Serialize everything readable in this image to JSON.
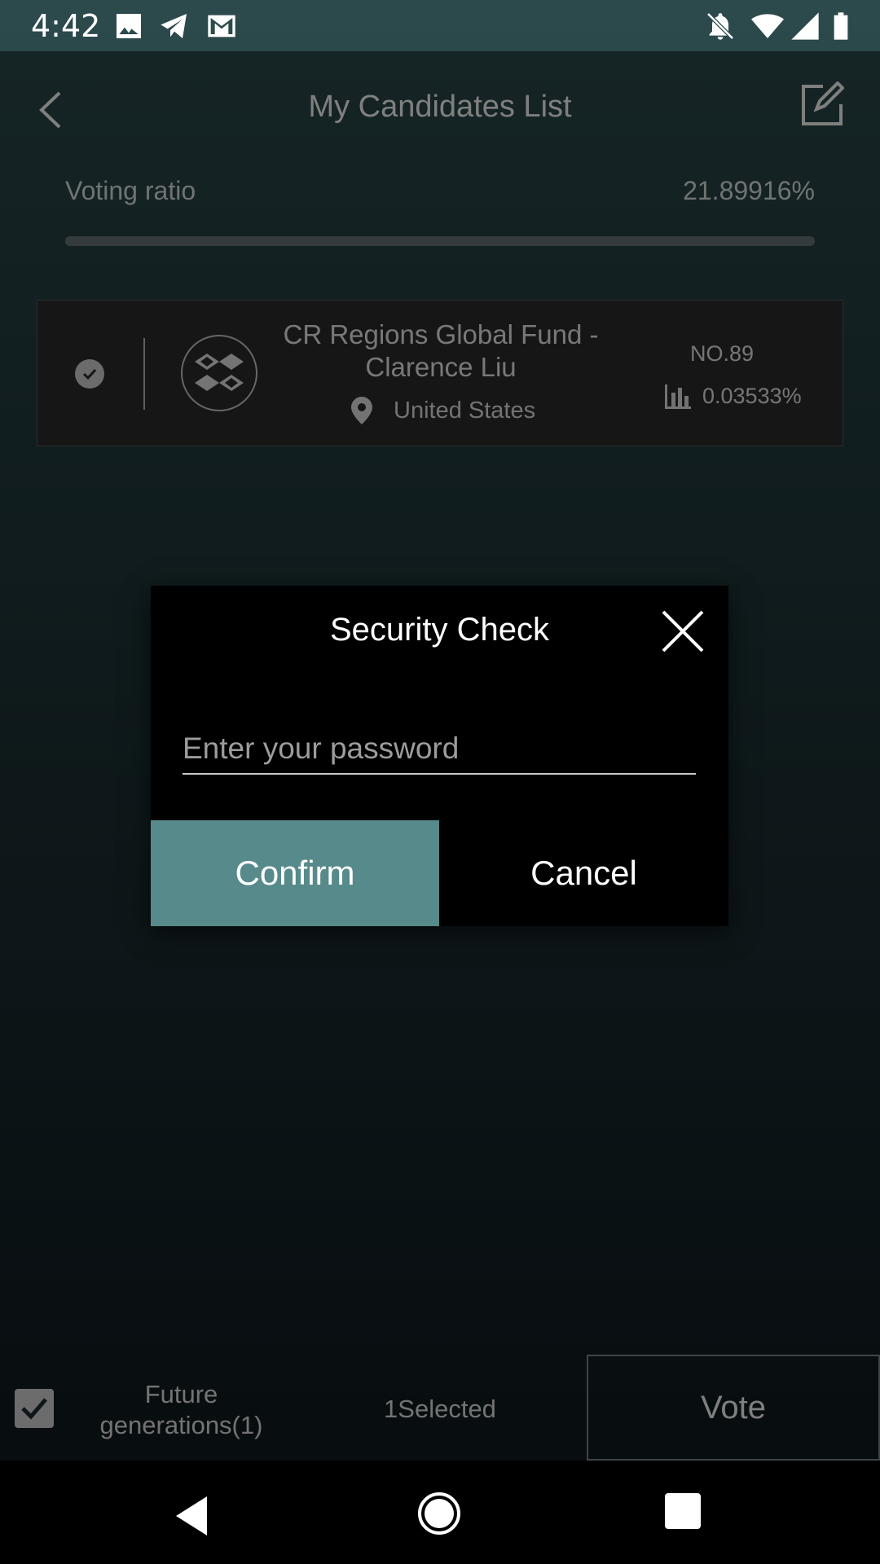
{
  "status_bar": {
    "time": "4:42",
    "icons_left": [
      "image-icon",
      "telegram-icon",
      "gmail-icon"
    ],
    "icons_right": [
      "notifications-off-icon",
      "wifi-icon",
      "signal-icon",
      "battery-icon"
    ]
  },
  "header": {
    "title": "My Candidates List",
    "back_icon": "chevron-left-icon",
    "edit_icon": "edit-icon"
  },
  "voting_ratio": {
    "label": "Voting ratio",
    "value": "21.89916%"
  },
  "candidate": {
    "name": "CR Regions Global Fund - Clarence Liu",
    "location": "United States",
    "rank": "NO.89",
    "share": "0.03533%",
    "checked": true
  },
  "dialog": {
    "title": "Security Check",
    "password_placeholder": "Enter your password",
    "password_value": "",
    "confirm_label": "Confirm",
    "cancel_label": "Cancel"
  },
  "bottom_bar": {
    "future_label": "Future generations(1)",
    "selected_label": "1Selected",
    "vote_label": "Vote"
  },
  "colors": {
    "confirm_bg": "#578a8a",
    "dialog_bg": "#000000",
    "background_top": "#2c4a4c",
    "background_bottom": "#0e1619"
  }
}
